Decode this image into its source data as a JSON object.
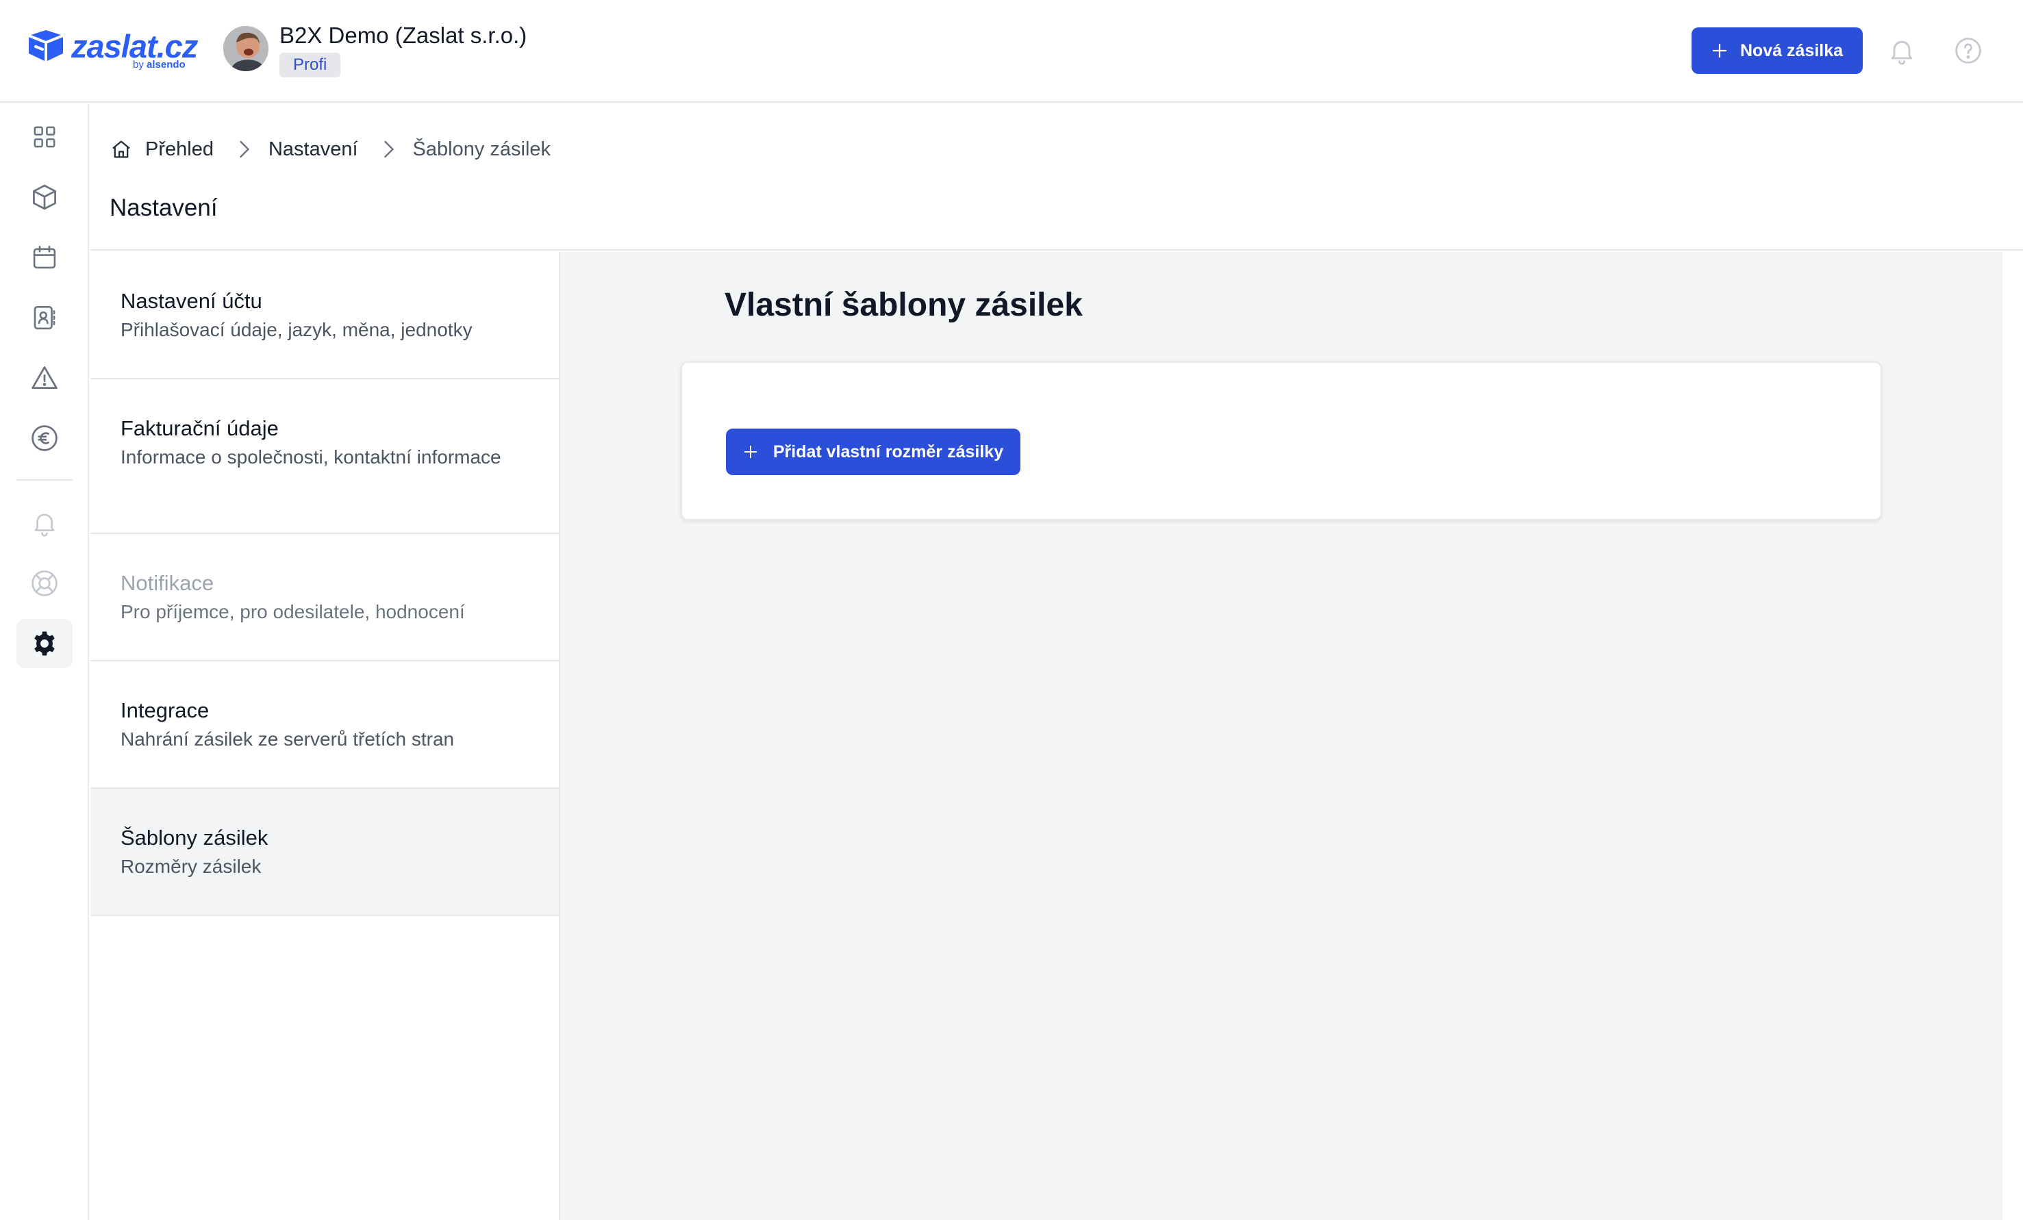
{
  "brand": {
    "name": "zaslat.cz",
    "by": "by",
    "partner": "alsendo",
    "color": "#2b5ef7"
  },
  "account": {
    "company": "B2X Demo (Zaslat s.r.o.)",
    "plan": "Profi"
  },
  "header": {
    "new_shipment_label": "Nová zásilka",
    "icons": [
      "bell-icon",
      "help-icon"
    ]
  },
  "rail": {
    "items": [
      "dashboard-grid-icon",
      "package-icon",
      "calendar-icon",
      "address-book-icon",
      "warning-icon",
      "euro-icon",
      "bell-icon",
      "support-lifebuoy-icon",
      "settings-gear-icon"
    ],
    "active": "settings-gear-icon"
  },
  "breadcrumb": {
    "home": "Přehled",
    "section": "Nastavení",
    "current": "Šablony zásilek"
  },
  "page_title": "Nastavení",
  "settings_menu": [
    {
      "title": "Nastavení účtu",
      "desc": "Přihlašovací údaje, jazyk, měna, jednotky"
    },
    {
      "title": "Fakturační údaje",
      "desc": "Informace o společnosti, kontaktní informace"
    },
    {
      "title": "Notifikace",
      "desc": "Pro příjemce, pro odesilatele, hodnocení"
    },
    {
      "title": "Integrace",
      "desc": "Nahrání zásilek ze serverů třetích stran"
    },
    {
      "title": "Šablony zásilek",
      "desc": "Rozměry zásilek"
    }
  ],
  "content": {
    "title": "Vlastní šablony zásilek",
    "add_button_label": "Přidat vlastní rozměr zásilky"
  },
  "colors": {
    "primary_button": "#2b4fd8",
    "content_bg": "#f3f4f6",
    "active_menu_bg": "#f3f4f6"
  }
}
